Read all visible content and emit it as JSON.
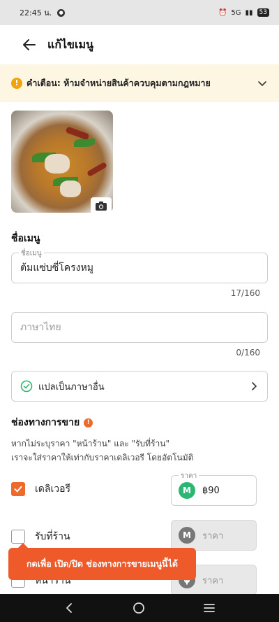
{
  "status_bar": {
    "time": "22:45 น.",
    "network": "5G",
    "battery": "53"
  },
  "header": {
    "title": "แก้ไขเมนู"
  },
  "warning": {
    "text": "คำเตือน: ห้ามจำหน่ายสินค้าควบคุมตามกฎหมาย"
  },
  "menu_name": {
    "section_title": "ชื่อเมนู",
    "field_label": "ชื่อเมนู",
    "value": "ต้มแซ่บซี่โครงหมู",
    "counter": "17/160"
  },
  "thai_name": {
    "placeholder": "ภาษาไทย",
    "counter": "0/160"
  },
  "translate": {
    "label": "แปลเป็นภาษาอื่น"
  },
  "channels": {
    "section_title": "ช่องทางการขาย",
    "hint_line1": "หากไม่ระบุราคา \"หน้าร้าน\" และ \"รับที่ร้าน\"",
    "hint_line2": "เราจะใส่ราคาให้เท่ากับราคาเดลิเวอรี โดยอัตโนมัติ",
    "items": [
      {
        "label": "เดลิเวอรี",
        "checked": true,
        "price_label": "ราคา",
        "price": "฿90"
      },
      {
        "label": "รับที่ร้าน",
        "checked": false,
        "price_placeholder": "ราคา"
      },
      {
        "label": "หน้าร้าน",
        "checked": false,
        "price_placeholder": "ราคา"
      }
    ]
  },
  "tooltip": {
    "text": "กดเพื่อ เปิด/ปิด ช่องทางการขายเมนูนี้ได้"
  },
  "colors": {
    "accent": "#ee6a2b",
    "warning_bg": "#fdf6e3",
    "green": "#2bb673"
  }
}
